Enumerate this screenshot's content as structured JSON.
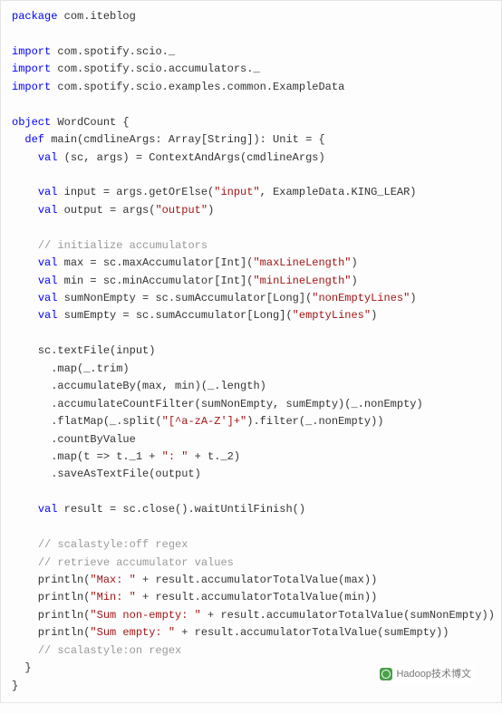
{
  "code": {
    "l1": "package",
    "l1b": " com.iteblog",
    "l3": "import",
    "l3b": " com.spotify.scio._",
    "l4": "import",
    "l4b": " com.spotify.scio.accumulators._",
    "l5": "import",
    "l5b": " com.spotify.scio.examples.common.ExampleData",
    "l7": "object",
    "l7b": " WordCount {",
    "l8a": "  ",
    "l8": "def",
    "l8b": " main(cmdlineArgs: Array[String]): Unit = {",
    "l9a": "    ",
    "l9": "val",
    "l9b": " (sc, args) = ContextAndArgs(cmdlineArgs)",
    "l11a": "    ",
    "l11": "val",
    "l11b": " input = args.getOrElse(",
    "l11s1": "\"input\"",
    "l11c": ", ExampleData.KING_LEAR)",
    "l12a": "    ",
    "l12": "val",
    "l12b": " output = args(",
    "l12s1": "\"output\"",
    "l12c": ")",
    "l14a": "    ",
    "l14": "// initialize accumulators",
    "l15a": "    ",
    "l15": "val",
    "l15b": " max = sc.maxAccumulator[Int](",
    "l15s1": "\"maxLineLength\"",
    "l15c": ")",
    "l16a": "    ",
    "l16": "val",
    "l16b": " min = sc.minAccumulator[Int](",
    "l16s1": "\"minLineLength\"",
    "l16c": ")",
    "l17a": "    ",
    "l17": "val",
    "l17b": " sumNonEmpty = sc.sumAccumulator[Long](",
    "l17s1": "\"nonEmptyLines\"",
    "l17c": ")",
    "l18a": "    ",
    "l18": "val",
    "l18b": " sumEmpty = sc.sumAccumulator[Long](",
    "l18s1": "\"emptyLines\"",
    "l18c": ")",
    "l20": "    sc.textFile(input)",
    "l21": "      .map(_.trim)",
    "l22": "      .accumulateBy(max, min)(_.length)",
    "l23": "      .accumulateCountFilter(sumNonEmpty, sumEmpty)(_.nonEmpty)",
    "l24a": "      .flatMap(_.split(",
    "l24s1": "\"[^a-zA-Z']+\"",
    "l24b": ").filter(_.nonEmpty))",
    "l25": "      .countByValue",
    "l26a": "      .map(t => t._1 + ",
    "l26s1": "\": \"",
    "l26b": " + t._2)",
    "l27": "      .saveAsTextFile(output)",
    "l29a": "    ",
    "l29": "val",
    "l29b": " result = sc.close().waitUntilFinish()",
    "l31a": "    ",
    "l31": "// scalastyle:off regex",
    "l32a": "    ",
    "l32": "// retrieve accumulator values",
    "l33a": "    println(",
    "l33s1": "\"Max: \"",
    "l33b": " + result.accumulatorTotalValue(max))",
    "l34a": "    println(",
    "l34s1": "\"Min: \"",
    "l34b": " + result.accumulatorTotalValue(min))",
    "l35a": "    println(",
    "l35s1": "\"Sum non-empty: \"",
    "l35b": " + result.accumulatorTotalValue(sumNonEmpty))",
    "l36a": "    println(",
    "l36s1": "\"Sum empty: \"",
    "l36b": " + result.accumulatorTotalValue(sumEmpty))",
    "l37a": "    ",
    "l37": "// scalastyle:on regex",
    "l38": "  }",
    "l39": "}"
  },
  "watermark": "Hadoop技术博文"
}
